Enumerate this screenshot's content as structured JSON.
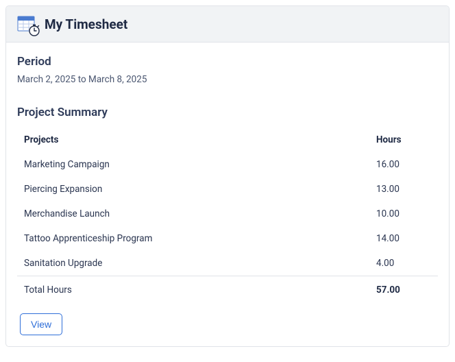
{
  "header": {
    "title": "My Timesheet"
  },
  "period": {
    "label": "Period",
    "text": "March 2, 2025 to March 8, 2025"
  },
  "summary": {
    "heading": "Project Summary",
    "columns": {
      "projects": "Projects",
      "hours": "Hours"
    },
    "rows": [
      {
        "project": "Marketing Campaign",
        "hours": "16.00"
      },
      {
        "project": "Piercing Expansion",
        "hours": "13.00"
      },
      {
        "project": "Merchandise Launch",
        "hours": "10.00"
      },
      {
        "project": "Tattoo Apprenticeship Program",
        "hours": "14.00"
      },
      {
        "project": "Sanitation Upgrade",
        "hours": "4.00"
      }
    ],
    "total": {
      "label": "Total Hours",
      "value": "57.00"
    }
  },
  "actions": {
    "view": "View"
  }
}
